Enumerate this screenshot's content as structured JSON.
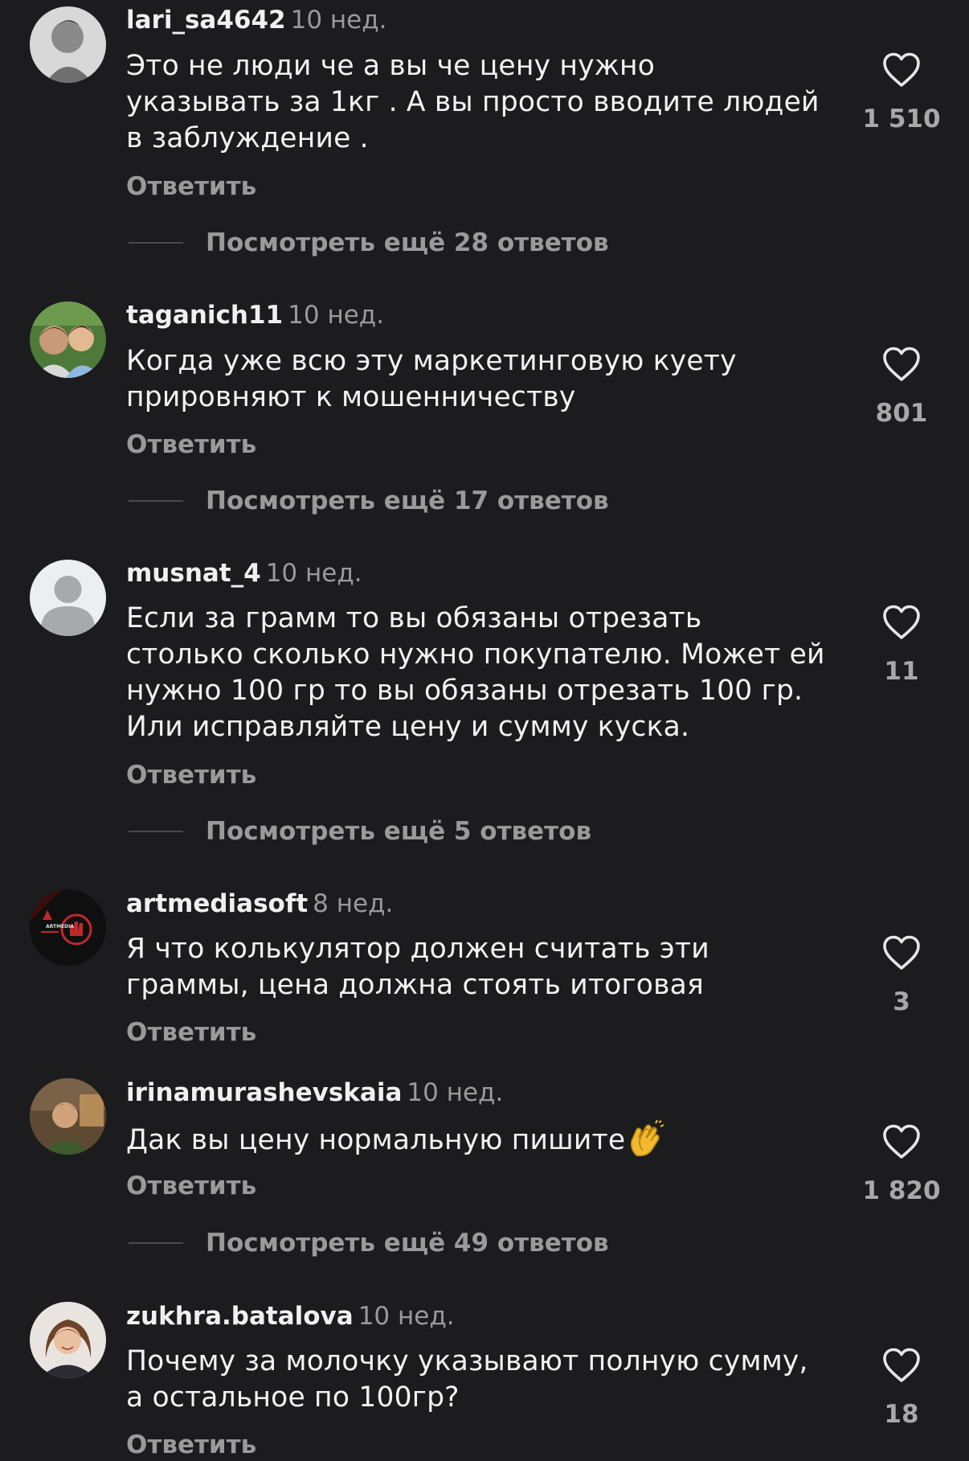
{
  "reply_label": "Ответить",
  "comments": [
    {
      "username": "lari_sa4642",
      "time": "10 нед.",
      "text": "Это не люди че а вы че  цену нужно\nуказывать за 1кг . А вы просто вводите людей\nв заблуждение .",
      "likes": "1 510",
      "more_replies": "Посмотреть ещё 28 ответов"
    },
    {
      "username": "taganich11",
      "time": "10 нед.",
      "text": "Когда уже всю эту маркетинговую куету\nприровняют к мошенничеству",
      "likes": "801",
      "more_replies": "Посмотреть ещё 17 ответов"
    },
    {
      "username": "musnat_4",
      "time": "10 нед.",
      "text": "Если за грамм то вы обязаны отрезать\nстолько сколько нужно покупателю. Может ей\nнужно 100 гр то вы обязаны отрезать 100 гр.\nИли исправляйте цену и сумму куска.",
      "likes": "11",
      "more_replies": "Посмотреть ещё 5 ответов"
    },
    {
      "username": "artmediasoft",
      "time": "8 нед.",
      "text": "Я что колькулятор должен считать эти\nграммы, цена должна стоять итоговая",
      "likes": "3",
      "avatar_text": "ARTMEDIA"
    },
    {
      "username": "irinamurashevskaia",
      "time": "10 нед.",
      "text": "Дак вы цену нормальную пишите",
      "likes": "1 820",
      "more_replies": "Посмотреть ещё 49 ответов"
    },
    {
      "username": "zukhra.batalova",
      "time": "10 нед.",
      "text": "Почему за молочку указывают полную сумму,\nа остальное по 100гр?",
      "likes": "18"
    }
  ],
  "colors": {
    "background": "#1c1c1e",
    "text": "#f2f2f2",
    "secondary": "#9a9a9a",
    "icon": "#e6e6e6"
  },
  "icons": {
    "like": "heart-outline-icon",
    "clap": "clapping-hands-emoji"
  }
}
